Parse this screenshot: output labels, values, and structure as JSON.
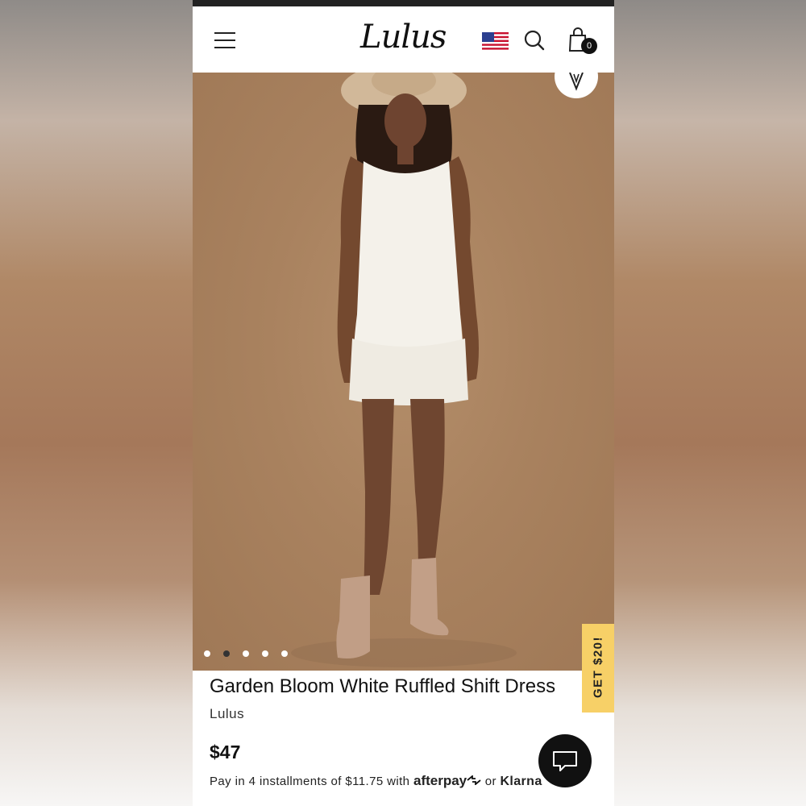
{
  "header": {
    "logo_text": "Lulus",
    "cart_count": "0",
    "icons": [
      "hamburger-menu-icon",
      "us-flag-icon",
      "search-icon",
      "shopping-bag-icon"
    ]
  },
  "gallery": {
    "total_images": 5,
    "active_index": 1,
    "wishlist_icon": "heart-leaf-icon"
  },
  "promo": {
    "label": "GET $20!",
    "color": "#f7d067"
  },
  "product": {
    "title": "Garden Bloom White Ruffled Shift Dress",
    "brand": "Lulus",
    "price": "$47",
    "installments_text": "Pay in 4 installments of $11.75 with",
    "afterpay_label": "afterpay",
    "or_text": "or",
    "klarna_label": "Klarna"
  },
  "chat": {
    "icon": "chat-bubble-icon"
  }
}
